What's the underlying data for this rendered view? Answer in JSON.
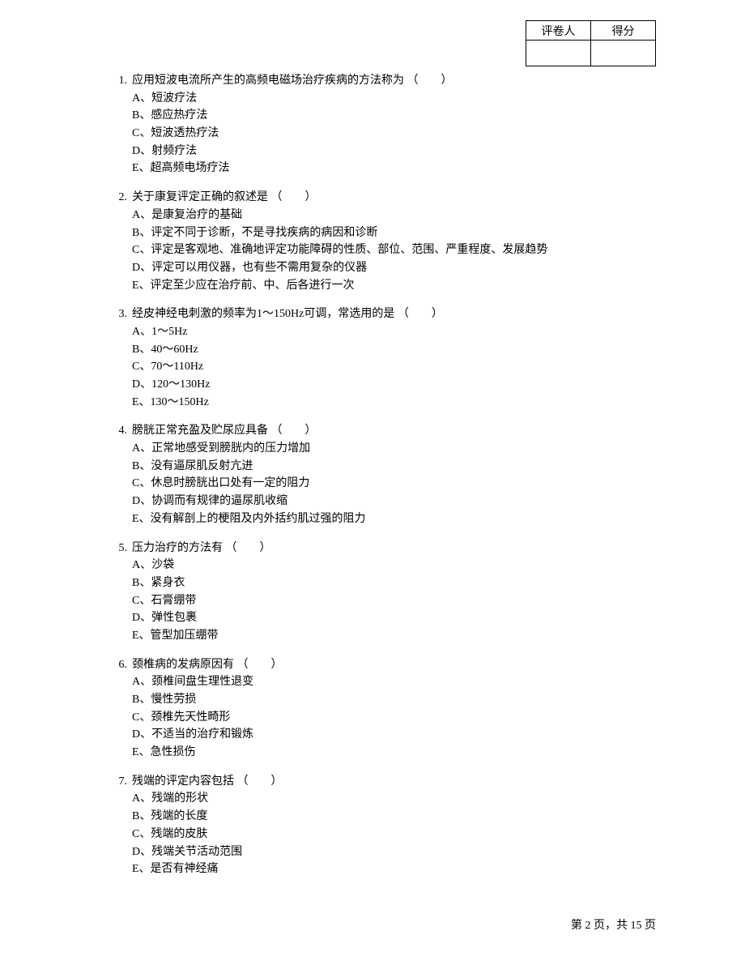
{
  "score_box": {
    "grader_label": "评卷人",
    "score_label": "得分"
  },
  "questions": [
    {
      "num": "1.",
      "stem": "应用短波电流所产生的高频电磁场治疗疾病的方法称为  （　　）",
      "options": [
        "A、短波疗法",
        "B、感应热疗法",
        "C、短波透热疗法",
        "D、射频疗法",
        "E、超高频电场疗法"
      ]
    },
    {
      "num": "2.",
      "stem": "关于康复评定正确的叙述是  （　　）",
      "options": [
        "A、是康复治疗的基础",
        "B、评定不同于诊断，不是寻找疾病的病因和诊断",
        "C、评定是客观地、准确地评定功能障碍的性质、部位、范围、严重程度、发展趋势",
        "D、评定可以用仪器，也有些不需用复杂的仪器",
        "E、评定至少应在治疗前、中、后各进行一次"
      ]
    },
    {
      "num": "3.",
      "stem": "经皮神经电刺激的频率为1～150Hz可调，常选用的是  （　　）",
      "options": [
        "A、1～5Hz",
        "B、40～60Hz",
        "C、70～110Hz",
        "D、120～130Hz",
        "E、130～150Hz"
      ]
    },
    {
      "num": "4.",
      "stem": "膀胱正常充盈及贮尿应具备  （　　）",
      "options": [
        "A、正常地感受到膀胱内的压力增加",
        "B、没有逼尿肌反射亢进",
        "C、休息时膀胱出口处有一定的阻力",
        "D、协调而有规律的逼尿肌收缩",
        "E、没有解剖上的梗阻及内外括约肌过强的阻力"
      ]
    },
    {
      "num": "5.",
      "stem": "压力治疗的方法有  （　　）",
      "options": [
        "A、沙袋",
        "B、紧身衣",
        "C、石膏绷带",
        "D、弹性包裹",
        "E、管型加压绷带"
      ]
    },
    {
      "num": "6.",
      "stem": "颈椎病的发病原因有  （　　）",
      "options": [
        "A、颈椎间盘生理性退变",
        "B、慢性劳损",
        "C、颈椎先天性畸形",
        "D、不适当的治疗和锻炼",
        "E、急性损伤"
      ]
    },
    {
      "num": "7.",
      "stem": "残端的评定内容包括  （　　）",
      "options": [
        "A、残端的形状",
        "B、残端的长度",
        "C、残端的皮肤",
        "D、残端关节活动范围",
        "E、是否有神经痛"
      ]
    }
  ],
  "footer": {
    "text": "第 2 页，共 15 页"
  }
}
